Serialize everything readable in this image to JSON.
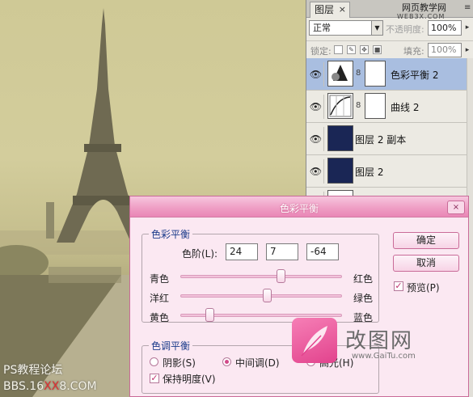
{
  "photo": {
    "watermark_line1": "PS教程论坛",
    "watermark_pre": "BBS.16",
    "watermark_mark": "XX",
    "watermark_post": "8.COM"
  },
  "layers_panel": {
    "tab_label": "图层",
    "tab_close": "×",
    "site_watermark": "网页教学网",
    "site_watermark_url": "WEB3X.COM",
    "menu_icon": "panel-menu-icon",
    "blend_mode": "正常",
    "opacity_label": "不透明度:",
    "opacity_value": "100%",
    "lock_label": "锁定:",
    "fill_label": "填充:",
    "fill_value": "100%",
    "layers": [
      {
        "name": "色彩平衡 2",
        "visible": true,
        "selected": true,
        "kind": "adjustment-color-balance"
      },
      {
        "name": "曲线 2",
        "visible": true,
        "selected": false,
        "kind": "adjustment-curves"
      },
      {
        "name": "图层 2 副本",
        "visible": true,
        "selected": false,
        "kind": "pixel"
      },
      {
        "name": "图层 2",
        "visible": true,
        "selected": false,
        "kind": "pixel"
      }
    ]
  },
  "dialog": {
    "title": "色彩平衡",
    "close_icon": "×",
    "balance_group_label": "色彩平衡",
    "levels_label": "色阶(L):",
    "levels": [
      "24",
      "7",
      "-64"
    ],
    "sliders": [
      {
        "left": "青色",
        "right": "红色",
        "value": 24
      },
      {
        "left": "洋红",
        "right": "绿色",
        "value": 7
      },
      {
        "left": "黄色",
        "right": "蓝色",
        "value": -64
      }
    ],
    "tone_group_label": "色调平衡",
    "tones": [
      {
        "label": "阴影(S)",
        "checked": false
      },
      {
        "label": "中间调(D)",
        "checked": true
      },
      {
        "label": "高光(H)",
        "checked": false
      }
    ],
    "preserve_label": "保持明度(V)",
    "preserve_checked": true,
    "ok_label": "确定",
    "cancel_label": "取消",
    "preview_label": "预览(P)",
    "preview_checked": true,
    "brand_name": "改图网",
    "brand_url": "www.GaiTu.com"
  },
  "colors": {
    "dialog_accent": "#e986b6",
    "selected_layer": "#a9bee0",
    "layer_thumb_fill": "#1a2655"
  }
}
